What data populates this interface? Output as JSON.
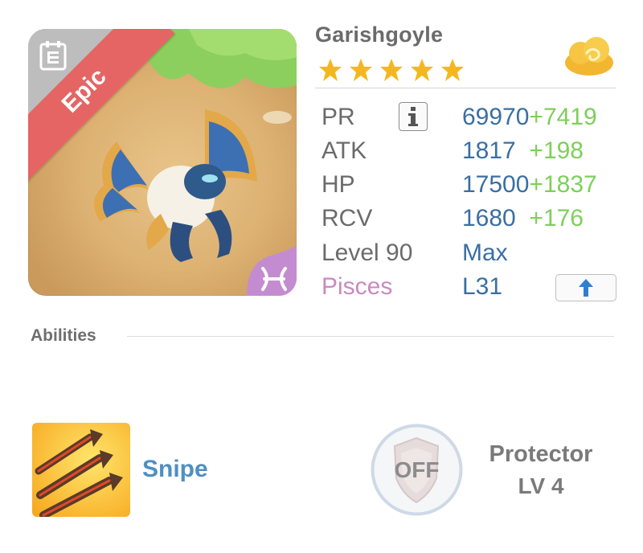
{
  "monster": {
    "name": "Garishgoyle",
    "rarity": "Epic",
    "star_count": 5,
    "sign": "Pisces",
    "sign_level": "L31"
  },
  "stats": {
    "pr": {
      "label": "PR",
      "value": "69970",
      "bonus": "+7419"
    },
    "atk": {
      "label": "ATK",
      "value": "1817",
      "bonus": "+198"
    },
    "hp": {
      "label": "HP",
      "value": "17500",
      "bonus": "+1837"
    },
    "rcv": {
      "label": "RCV",
      "value": "1680",
      "bonus": "+176"
    },
    "level": {
      "label": "Level 90",
      "value": "Max"
    }
  },
  "abilities": {
    "title": "Abilities",
    "primary": {
      "name": "Snipe"
    },
    "secondary": {
      "name": "Protector",
      "level": "LV 4",
      "state": "OFF"
    }
  },
  "colors": {
    "rarity_ribbon": "#e56565",
    "stat_value": "#3a6fa3",
    "stat_bonus": "#7ecf5a",
    "sign": "#c98ac0",
    "ability_link": "#4f8fc2"
  },
  "icons": {
    "details": "document-icon",
    "info": "info-icon",
    "upgrade": "arrow-up-icon",
    "currency": "cloud-icon",
    "sign_badge": "pisces-icon"
  }
}
